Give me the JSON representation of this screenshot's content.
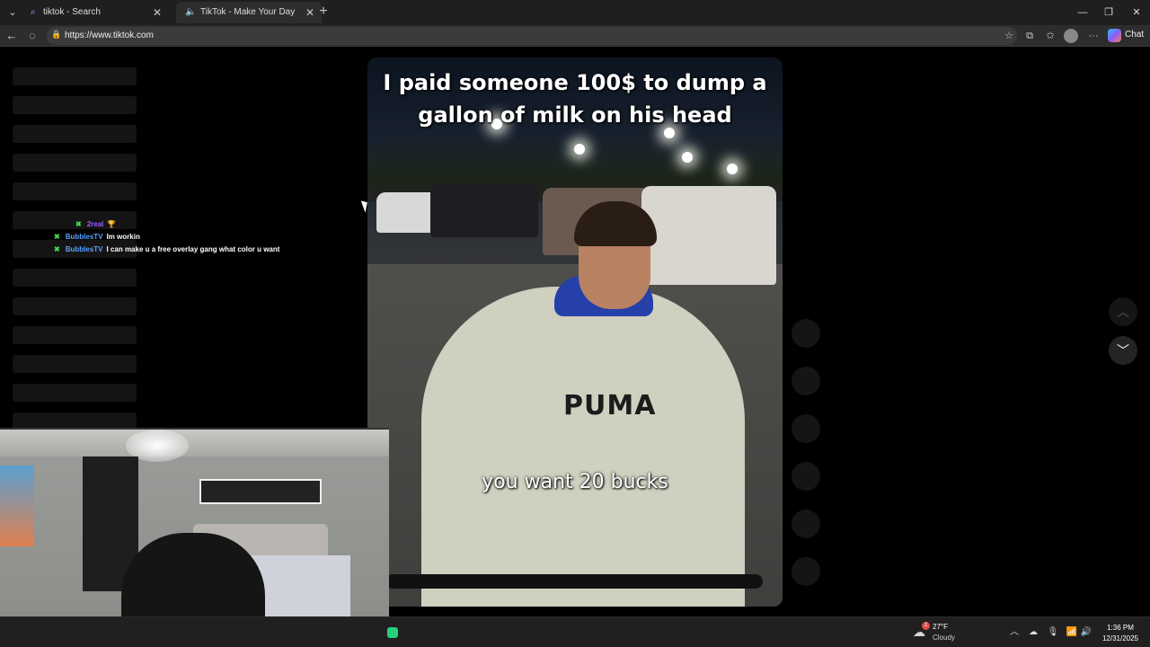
{
  "browser": {
    "tabs": [
      {
        "label": "tiktok - Search",
        "icon": "search-icon",
        "active": false
      },
      {
        "label": "TikTok - Make Your Day",
        "icon": "speaker-icon",
        "active": true
      }
    ],
    "url": "https://www.tiktok.com",
    "copilot_label": "Chat"
  },
  "video": {
    "caption_top": "I paid someone 100$ to dump a gallon of milk on his head",
    "caption_bottom": "you want 20 bucks",
    "shirt_brand": "PUMA"
  },
  "chat_overlay": [
    {
      "user": "2real",
      "message": "🏆"
    },
    {
      "user": "BubblesTV",
      "message": "Im workin"
    },
    {
      "user": "BubblesTV",
      "message": "I can make u a free overlay gang what color u want"
    }
  ],
  "taskbar": {
    "weather_temp": "27°F",
    "weather_condition": "Cloudy",
    "weather_badge": "2",
    "time": "1:36 PM",
    "date": "12/31/2025"
  },
  "colors": {
    "chat_mod_badge": "#3ddc55",
    "chat_user_1": "#9b59ff",
    "chat_user_2": "#5aa0ff",
    "taskbar_app": "#24d17a"
  }
}
